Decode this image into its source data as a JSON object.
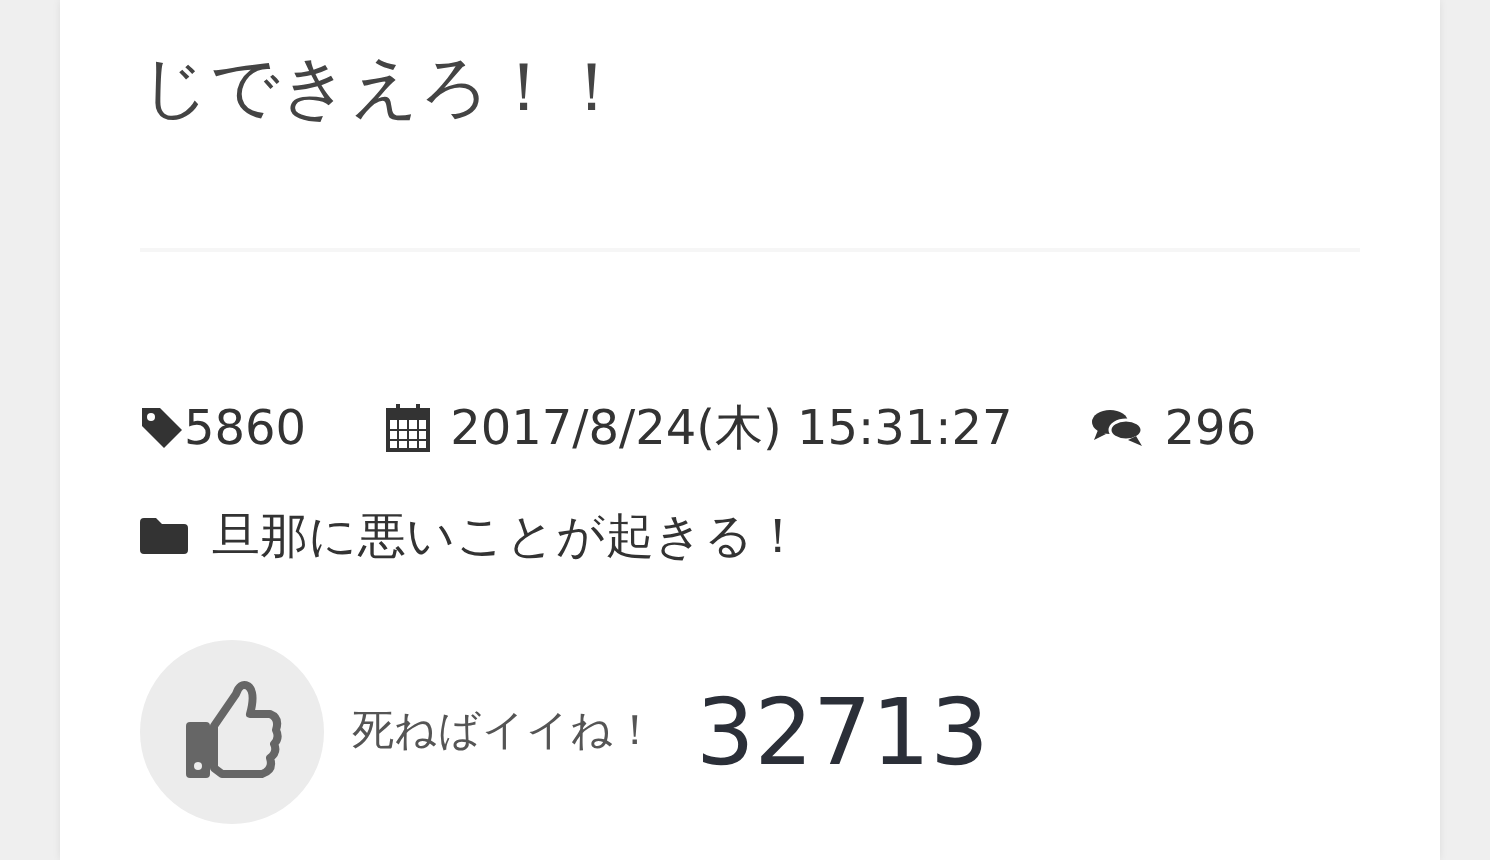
{
  "post": {
    "body_tail": "じできえろ！！"
  },
  "meta": {
    "tag_count": "5860",
    "date": "2017/8/24(木) 15:31:27",
    "comments": "296",
    "category": "旦那に悪いことが起きる！"
  },
  "like": {
    "label": "死ねばイイね！",
    "count": "32713"
  }
}
